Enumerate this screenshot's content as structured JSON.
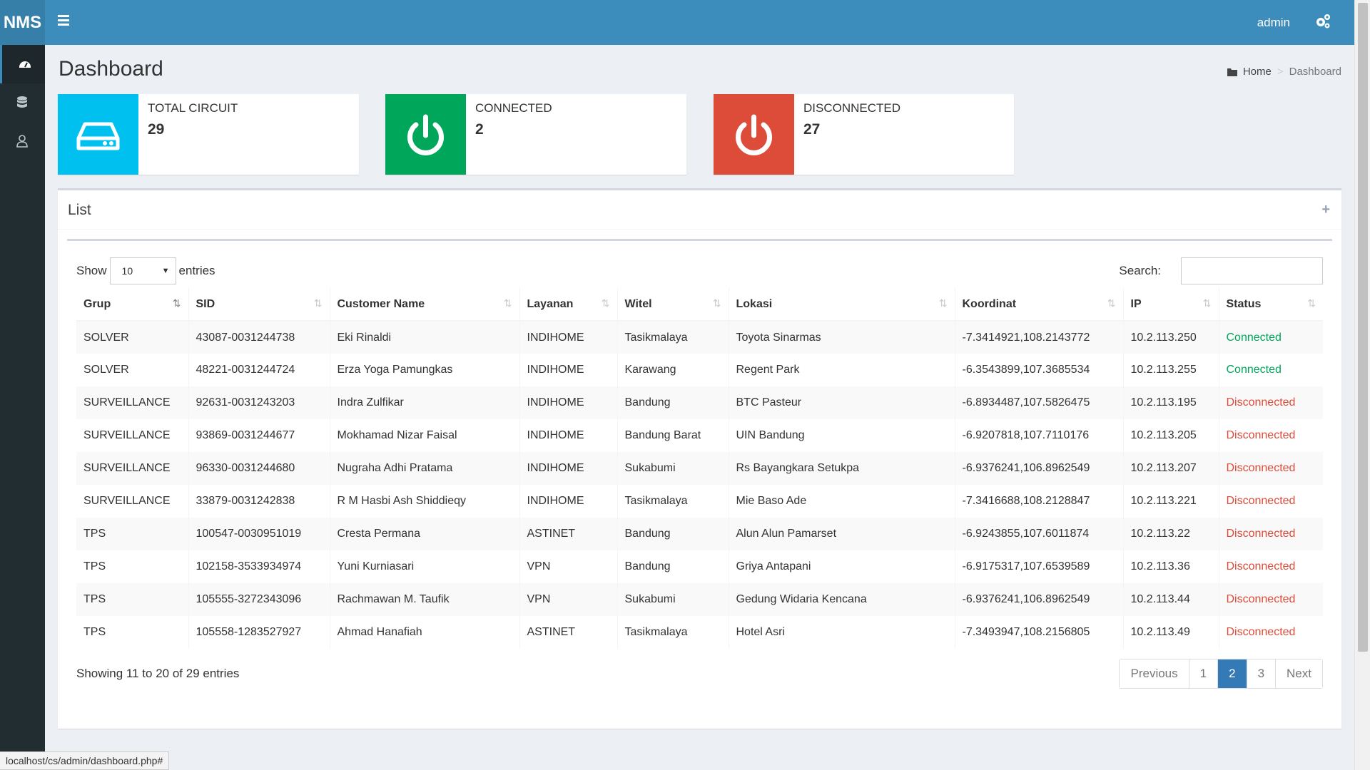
{
  "app": {
    "logo": "NMS",
    "user": "admin"
  },
  "page": {
    "title": "Dashboard",
    "breadcrumb": {
      "home": "Home",
      "current": "Dashboard"
    }
  },
  "stats": [
    {
      "label": "TOTAL CIRCUIT",
      "value": "29",
      "color": "#00c0ef",
      "icon": "hard-drive-icon"
    },
    {
      "label": "CONNECTED",
      "value": "2",
      "color": "#00a65a",
      "icon": "power-icon"
    },
    {
      "label": "DISCONNECTED",
      "value": "27",
      "color": "#dd4b39",
      "icon": "power-icon"
    }
  ],
  "list": {
    "title": "List",
    "show_label": "Show",
    "entries_label": "entries",
    "page_size": "10",
    "search_label": "Search:",
    "search_value": "",
    "columns": [
      "Grup",
      "SID",
      "Customer Name",
      "Layanan",
      "Witel",
      "Lokasi",
      "Koordinat",
      "IP",
      "Status"
    ],
    "rows": [
      [
        "SOLVER",
        "43087-0031244738",
        "Eki Rinaldi",
        "INDIHOME",
        "Tasikmalaya",
        "Toyota Sinarmas",
        "-7.3414921,108.2143772",
        "10.2.113.250",
        "Connected"
      ],
      [
        "SOLVER",
        "48221-0031244724",
        "Erza Yoga Pamungkas",
        "INDIHOME",
        "Karawang",
        "Regent Park",
        "-6.3543899,107.3685534",
        "10.2.113.255",
        "Connected"
      ],
      [
        "SURVEILLANCE",
        "92631-0031243203",
        "Indra Zulfikar",
        "INDIHOME",
        "Bandung",
        "BTC Pasteur",
        "-6.8934487,107.5826475",
        "10.2.113.195",
        "Disconnected"
      ],
      [
        "SURVEILLANCE",
        "93869-0031244677",
        "Mokhamad Nizar Faisal",
        "INDIHOME",
        "Bandung Barat",
        "UIN Bandung",
        "-6.9207818,107.7110176",
        "10.2.113.205",
        "Disconnected"
      ],
      [
        "SURVEILLANCE",
        "96330-0031244680",
        "Nugraha Adhi Pratama",
        "INDIHOME",
        "Sukabumi",
        "Rs Bayangkara Setukpa",
        "-6.9376241,106.8962549",
        "10.2.113.207",
        "Disconnected"
      ],
      [
        "SURVEILLANCE",
        "33879-0031242838",
        "R M Hasbi Ash Shiddieqy",
        "INDIHOME",
        "Tasikmalaya",
        "Mie Baso Ade",
        "-7.3416688,108.2128847",
        "10.2.113.221",
        "Disconnected"
      ],
      [
        "TPS",
        "100547-0030951019",
        "Cresta Permana",
        "ASTINET",
        "Bandung",
        "Alun Alun Pamarset",
        "-6.9243855,107.6011874",
        "10.2.113.22",
        "Disconnected"
      ],
      [
        "TPS",
        "102158-3533934974",
        "Yuni Kurniasari",
        "VPN",
        "Bandung",
        "Griya Antapani",
        "-6.9175317,107.6539589",
        "10.2.113.36",
        "Disconnected"
      ],
      [
        "TPS",
        "105555-3272343096",
        "Rachmawan M. Taufik",
        "VPN",
        "Sukabumi",
        "Gedung Widaria Kencana",
        "-6.9376241,106.8962549",
        "10.2.113.44",
        "Disconnected"
      ],
      [
        "TPS",
        "105558-1283527927",
        "Ahmad Hanafiah",
        "ASTINET",
        "Tasikmalaya",
        "Hotel Asri",
        "-7.3493947,108.2156805",
        "10.2.113.49",
        "Disconnected"
      ]
    ],
    "footer_info": "Showing 11 to 20 of 29 entries",
    "pagination": {
      "previous": "Previous",
      "pages": [
        "1",
        "2",
        "3"
      ],
      "active": "2",
      "next": "Next"
    }
  },
  "status_bar": "localhost/cs/admin/dashboard.php#"
}
